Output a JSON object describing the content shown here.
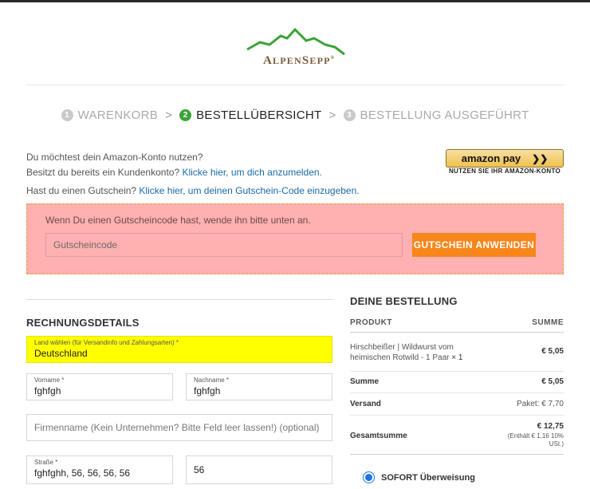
{
  "brand": {
    "name_big1": "A",
    "name_small1": "LPEN",
    "name_big2": "S",
    "name_small2": "EPP",
    "reg": "®",
    "mountain_color": "#3aa336"
  },
  "steps": [
    {
      "num": "1",
      "label": "WARENKORB",
      "active": false
    },
    {
      "num": "2",
      "label": "BESTELLÜBERSICHT",
      "active": true
    },
    {
      "num": "3",
      "label": "BESTELLUNG AUSGEFÜHRT",
      "active": false
    }
  ],
  "step_separator": ">",
  "amazon": {
    "question": "Du möchtest dein Amazon-Konto nutzen?",
    "login_prefix": "Besitzt du bereits ein Kundenkonto? ",
    "login_link": "Klicke hier, um dich anzumelden.",
    "button_label": "amazon pay",
    "button_icon": "chevron-right-icon",
    "caption": "NUTZEN SIE IHR AMAZON-KONTO"
  },
  "coupon": {
    "prefix": "Hast du einen Gutschein? ",
    "link": "Klicke hier, um deinen Gutschein-Code einzugeben.",
    "message": "Wenn Du einen Gutscheincode hast, wende ihn bitte unten an.",
    "placeholder": "Gutscheincode",
    "apply_label": "GUTSCHEIN ANWENDEN",
    "box_color": "#ffb0b0",
    "button_color": "#f7861b"
  },
  "billing": {
    "title": "RECHNUNGSDETAILS",
    "country": {
      "label": "Land wählen (für Versandinfo und Zahlungsarten) *",
      "value": "Deutschland"
    },
    "first_name": {
      "label": "Vorname *",
      "value": "fghfgh"
    },
    "last_name": {
      "label": "Nachname *",
      "value": "fghfgh"
    },
    "company": {
      "placeholder": "Firmenname (Kein Unternehmen? Bitte Feld leer lassen!) (optional)"
    },
    "street": {
      "label": "Straße *",
      "value": "fghfghh, 56, 56, 56, 56"
    },
    "house_number": {
      "value": "56"
    }
  },
  "order": {
    "title": "DEINE BESTELLUNG",
    "col_product": "PRODUKT",
    "col_sum": "SUMME",
    "item_line1": "Hirschbeißer | Wildwurst vom",
    "item_line2": "heimischen Rotwild - 1 Paar",
    "item_qty": "× 1",
    "item_price": "€ 5,05",
    "subtotal_label": "Summe",
    "subtotal_value": "€ 5,05",
    "shipping_label": "Versand",
    "shipping_value": "Paket: € 7,70",
    "total_label": "Gesamtsumme",
    "total_value": "€ 12,75",
    "tax_line1_prefix": "(Enthält ",
    "tax_line1_amount": "€ 1,16",
    "tax_line1_suffix": " 10%",
    "tax_line2": "USt.)"
  },
  "payment": {
    "label": "SOFORT Überweisung",
    "selected": true
  }
}
